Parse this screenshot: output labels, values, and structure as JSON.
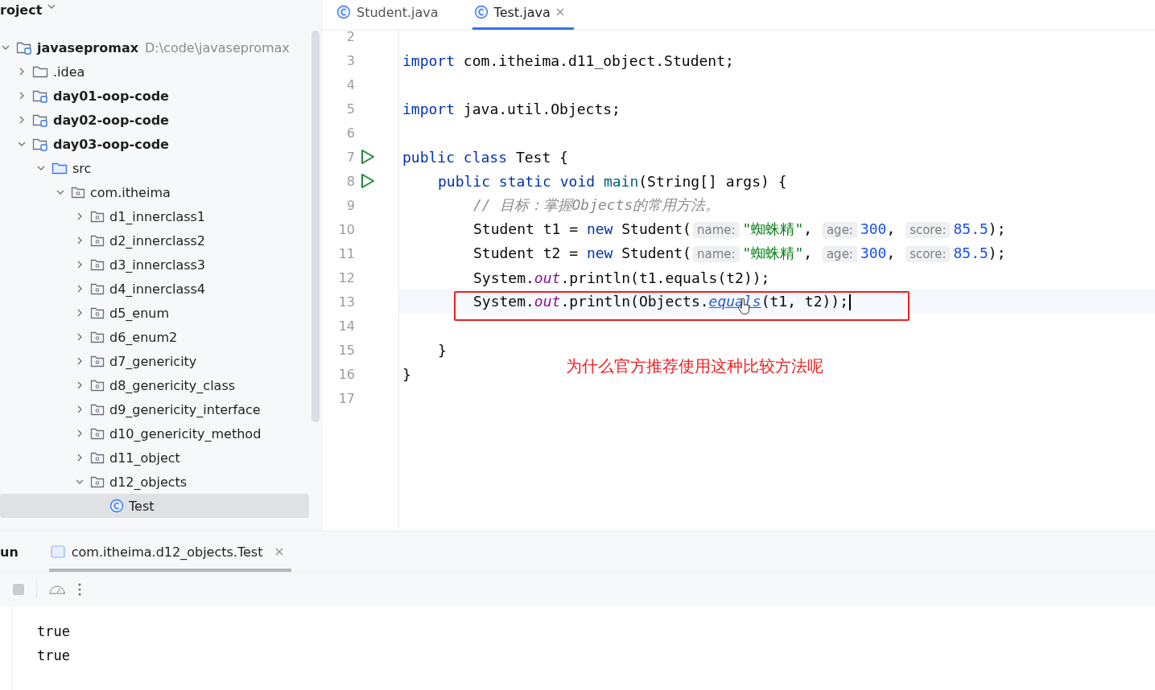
{
  "project_panel": {
    "title": "roject"
  },
  "tree": [
    {
      "label": "javasepromax",
      "path": "D:\\code\\javasepromax",
      "kind": "module",
      "expanded": true,
      "selected": false,
      "children": [
        {
          "label": ".idea",
          "kind": "folder",
          "expanded": false,
          "selected": false
        },
        {
          "label": "day01-oop-code",
          "kind": "module",
          "expanded": false,
          "selected": false
        },
        {
          "label": "day02-oop-code",
          "kind": "module",
          "expanded": false,
          "selected": false
        },
        {
          "label": "day03-oop-code",
          "kind": "module",
          "expanded": true,
          "selected": false,
          "children": [
            {
              "label": "src",
              "kind": "source",
              "expanded": true,
              "selected": false,
              "children": [
                {
                  "label": "com.itheima",
                  "kind": "package",
                  "expanded": true,
                  "selected": false,
                  "children": [
                    {
                      "label": "d1_innerclass1",
                      "kind": "package",
                      "expanded": false,
                      "selected": false
                    },
                    {
                      "label": "d2_innerclass2",
                      "kind": "package",
                      "expanded": false,
                      "selected": false
                    },
                    {
                      "label": "d3_innerclass3",
                      "kind": "package",
                      "expanded": false,
                      "selected": false
                    },
                    {
                      "label": "d4_innerclass4",
                      "kind": "package",
                      "expanded": false,
                      "selected": false
                    },
                    {
                      "label": "d5_enum",
                      "kind": "package",
                      "expanded": false,
                      "selected": false
                    },
                    {
                      "label": "d6_enum2",
                      "kind": "package",
                      "expanded": false,
                      "selected": false
                    },
                    {
                      "label": "d7_genericity",
                      "kind": "package",
                      "expanded": false,
                      "selected": false
                    },
                    {
                      "label": "d8_genericity_class",
                      "kind": "package",
                      "expanded": false,
                      "selected": false
                    },
                    {
                      "label": "d9_genericity_interface",
                      "kind": "package",
                      "expanded": false,
                      "selected": false
                    },
                    {
                      "label": "d10_genericity_method",
                      "kind": "package",
                      "expanded": false,
                      "selected": false
                    },
                    {
                      "label": "d11_object",
                      "kind": "package",
                      "expanded": false,
                      "selected": false
                    },
                    {
                      "label": "d12_objects",
                      "kind": "package",
                      "expanded": true,
                      "selected": false,
                      "children": [
                        {
                          "label": "Test",
                          "kind": "class",
                          "selected": true
                        }
                      ]
                    }
                  ]
                }
              ]
            }
          ]
        }
      ]
    }
  ],
  "editor_tabs": [
    {
      "label": "Student.java",
      "selected": false
    },
    {
      "label": "Test.java",
      "selected": true
    }
  ],
  "code_lines": [
    {
      "number": "2",
      "kind": "top"
    },
    {
      "number": "3",
      "kind": "top",
      "tokens": [
        {
          "kind": "kw",
          "text": "import"
        },
        {
          "kind": "plain",
          "text": " com.itheima.d11_object.Student;"
        }
      ]
    },
    {
      "number": "4",
      "kind": "top"
    },
    {
      "number": "5",
      "kind": "top",
      "tokens": [
        {
          "kind": "kw",
          "text": "import"
        },
        {
          "kind": "plain",
          "text": " java.util.Objects;"
        }
      ]
    },
    {
      "number": "6",
      "kind": "top"
    },
    {
      "number": "7",
      "kind": "top",
      "run": true,
      "tokens": [
        {
          "kind": "kw",
          "text": "public class"
        },
        {
          "kind": "plain",
          "text": " Test {"
        }
      ]
    },
    {
      "number": "8",
      "kind": "member",
      "run": true,
      "tokens": [
        {
          "kind": "kw",
          "text": "public static void"
        },
        {
          "kind": "decl",
          "text": "main",
          "spaced": true
        },
        {
          "kind": "plain",
          "text": "(String[] args) {"
        }
      ]
    },
    {
      "number": "9",
      "kind": "statement",
      "tokens": [
        {
          "kind": "comment",
          "text": "// 目标：掌握Objects的常用方法。"
        }
      ]
    },
    {
      "number": "10",
      "kind": "statement",
      "tokens": [
        {
          "kind": "plain",
          "text": "Student t1 = "
        },
        {
          "kind": "kw",
          "text": "new"
        },
        {
          "kind": "plain",
          "text": " Student("
        },
        {
          "kind": "hint",
          "text": "name:"
        },
        {
          "kind": "str",
          "text": "\"蜘蛛精\""
        },
        {
          "kind": "plain",
          "text": ", "
        },
        {
          "kind": "hint",
          "text": "age:"
        },
        {
          "kind": "num",
          "text": "300"
        },
        {
          "kind": "plain",
          "text": ", "
        },
        {
          "kind": "hint",
          "text": "score:"
        },
        {
          "kind": "num",
          "text": "85.5"
        },
        {
          "kind": "plain",
          "text": ");"
        }
      ]
    },
    {
      "number": "11",
      "kind": "statement",
      "tokens": [
        {
          "kind": "plain",
          "text": "Student t2 = "
        },
        {
          "kind": "kw",
          "text": "new"
        },
        {
          "kind": "plain",
          "text": " Student("
        },
        {
          "kind": "hint",
          "text": "name:"
        },
        {
          "kind": "str",
          "text": "\"蜘蛛精\""
        },
        {
          "kind": "plain",
          "text": ", "
        },
        {
          "kind": "hint",
          "text": "age:"
        },
        {
          "kind": "num",
          "text": "300"
        },
        {
          "kind": "plain",
          "text": ", "
        },
        {
          "kind": "hint",
          "text": "score:"
        },
        {
          "kind": "num",
          "text": "85.5"
        },
        {
          "kind": "plain",
          "text": ");"
        }
      ]
    },
    {
      "number": "12",
      "kind": "statement",
      "tokens": [
        {
          "kind": "plain",
          "text": "System."
        },
        {
          "kind": "field",
          "text": "out"
        },
        {
          "kind": "plain",
          "text": ".println(t1.equals(t2));"
        }
      ]
    },
    {
      "number": "13",
      "kind": "statement",
      "current": true,
      "boxed": true,
      "tokens": [
        {
          "kind": "plain",
          "text": "System."
        },
        {
          "kind": "field",
          "text": "out"
        },
        {
          "kind": "plain",
          "text": ".println(Objects."
        },
        {
          "kind": "link",
          "text": "equals"
        },
        {
          "kind": "plain",
          "text": "(t1, t2));"
        }
      ]
    },
    {
      "number": "14",
      "kind": "statement"
    },
    {
      "number": "15",
      "kind": "member",
      "tokens": [
        {
          "kind": "plain",
          "text": "}"
        }
      ]
    },
    {
      "number": "16",
      "kind": "top",
      "tokens": [
        {
          "kind": "plain",
          "text": "}"
        }
      ]
    },
    {
      "number": "17",
      "kind": "top"
    }
  ],
  "annotation": {
    "text": "为什么官方推荐使用这种比较方法呢"
  },
  "run_panel": {
    "title": "un",
    "tabs": [
      {
        "label": "com.itheima.d12_objects.Test",
        "selected": true
      }
    ],
    "output": [
      "true",
      "true"
    ]
  }
}
